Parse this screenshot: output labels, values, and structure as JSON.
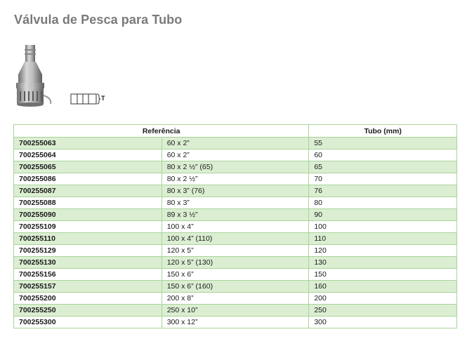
{
  "page": {
    "title": "Válvula de Pesca para Tubo"
  },
  "symbol": {
    "label": "T"
  },
  "table": {
    "headers": {
      "ref": "Referência",
      "tubo": "Tubo (mm)"
    },
    "rows": [
      {
        "ref": "700255063",
        "size": "60 x 2”",
        "tubo": "55"
      },
      {
        "ref": "700255064",
        "size": "60 x 2”",
        "tubo": "60"
      },
      {
        "ref": "700255065",
        "size": "80 x 2 ½” (65)",
        "tubo": "65"
      },
      {
        "ref": "700255086",
        "size": "80 x 2 ½”",
        "tubo": "70"
      },
      {
        "ref": "700255087",
        "size": "80 x 3” (76)",
        "tubo": "76"
      },
      {
        "ref": "700255088",
        "size": "80 x 3”",
        "tubo": "80"
      },
      {
        "ref": "700255090",
        "size": "89 x 3 ½”",
        "tubo": "90"
      },
      {
        "ref": "700255109",
        "size": "100 x 4”",
        "tubo": "100"
      },
      {
        "ref": "700255110",
        "size": "100 x 4” (110)",
        "tubo": "110"
      },
      {
        "ref": "700255129",
        "size": "120 x 5”",
        "tubo": "120"
      },
      {
        "ref": "700255130",
        "size": "120 x 5” (130)",
        "tubo": "130"
      },
      {
        "ref": "700255156",
        "size": "150 x 6”",
        "tubo": "150"
      },
      {
        "ref": "700255157",
        "size": "150 x 6” (160)",
        "tubo": "160"
      },
      {
        "ref": "700255200",
        "size": "200 x 8”",
        "tubo": "200"
      },
      {
        "ref": "700255250",
        "size": "250 x 10”",
        "tubo": "250"
      },
      {
        "ref": "700255300",
        "size": "300 x 12”",
        "tubo": "300"
      }
    ]
  }
}
